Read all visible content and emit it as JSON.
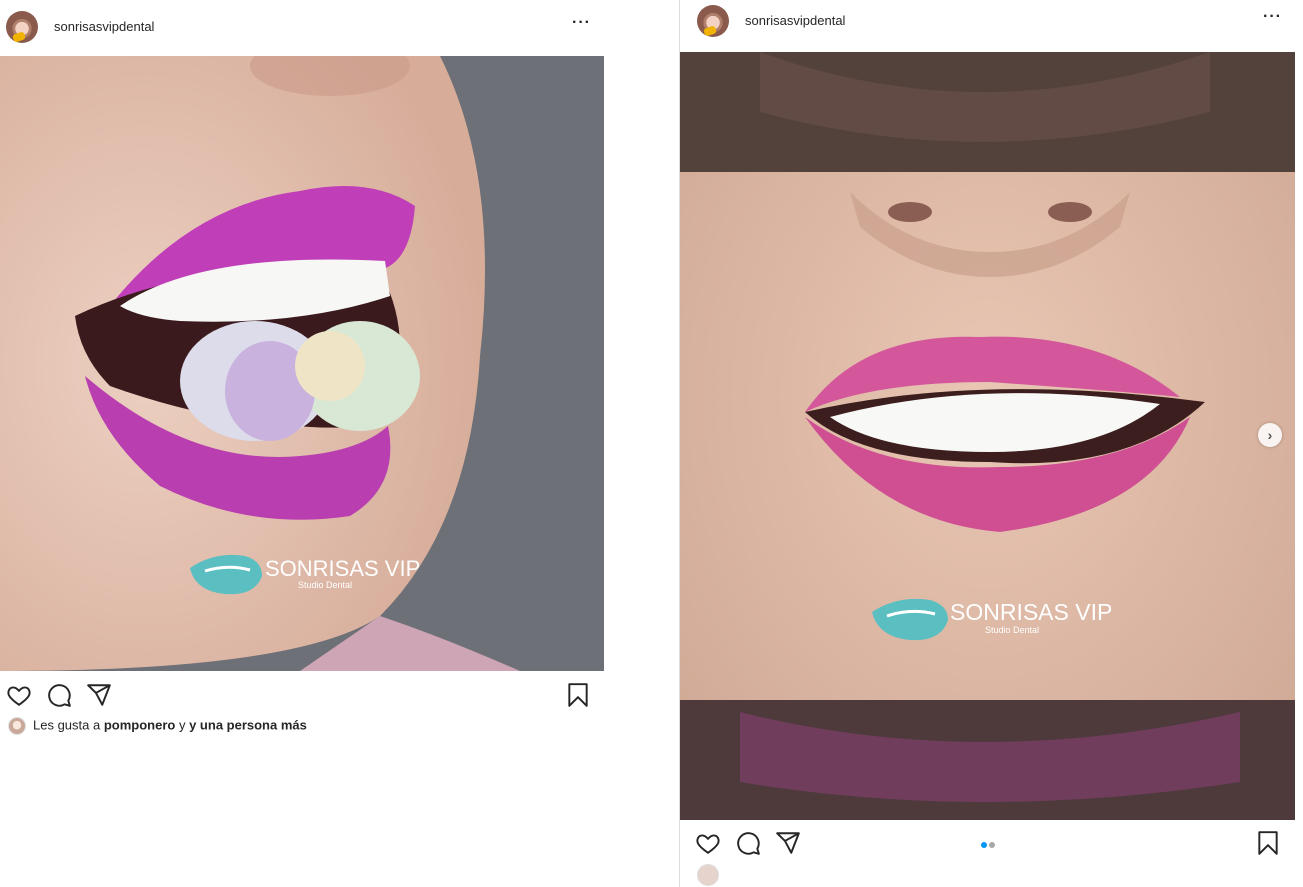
{
  "posts": [
    {
      "username": "sonrisasvipdental",
      "more_icon": "more-horizontal-icon",
      "brand_logo": {
        "title": "SONRISAS VIP",
        "subtitle": "Studio Dental",
        "color": "#5bbfc2"
      },
      "actions": [
        "heart-icon",
        "comment-icon",
        "share-icon",
        "bookmark-icon"
      ],
      "likes": {
        "prefix": "Les gusta a",
        "user": "pomponero",
        "connector": "y",
        "others": "y una persona más"
      }
    },
    {
      "username": "sonrisasvipdental",
      "more_icon": "more-horizontal-icon",
      "brand_logo": {
        "title": "SONRISAS VIP",
        "subtitle": "Studio Dental",
        "color": "#5bbfc2"
      },
      "actions": [
        "heart-icon",
        "comment-icon",
        "share-icon",
        "bookmark-icon"
      ],
      "carousel": {
        "total": 2,
        "active": 1,
        "active_color": "#0095f6",
        "inactive_color": "#a8a8a8"
      }
    }
  ],
  "colors": {
    "lip_magenta": "#c03fb8",
    "lip_pink": "#d4579b",
    "border": "#dbdbdb"
  }
}
